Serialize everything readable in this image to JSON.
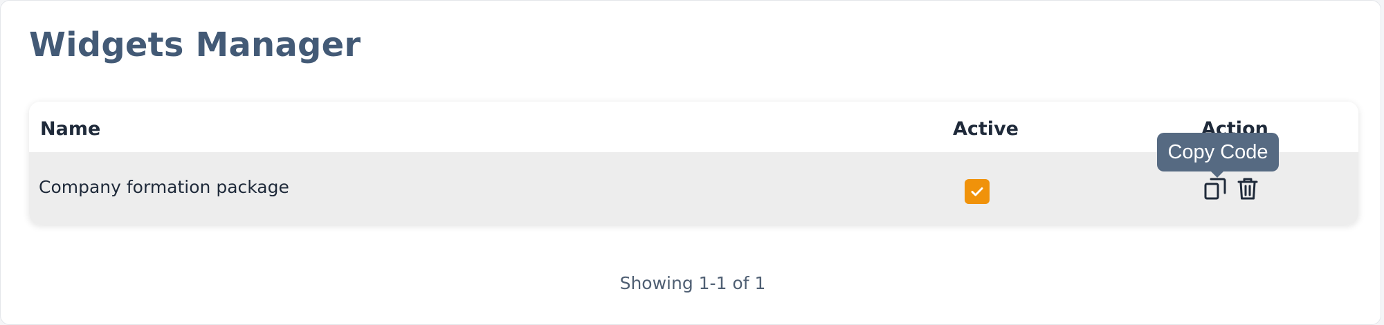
{
  "page": {
    "title": "Widgets Manager"
  },
  "table": {
    "columns": {
      "name": "Name",
      "active": "Active",
      "action": "Action"
    },
    "rows": [
      {
        "name": "Company formation package",
        "active": true,
        "actions": [
          "copy-icon",
          "trash-icon"
        ]
      }
    ]
  },
  "tooltip": {
    "label": "Copy Code"
  },
  "pagination": {
    "summary": "Showing 1-1 of 1"
  },
  "colors": {
    "title": "#435a76",
    "checkbox": "#f0920a",
    "tooltip": "#566a82",
    "row_background": "#ededed"
  }
}
